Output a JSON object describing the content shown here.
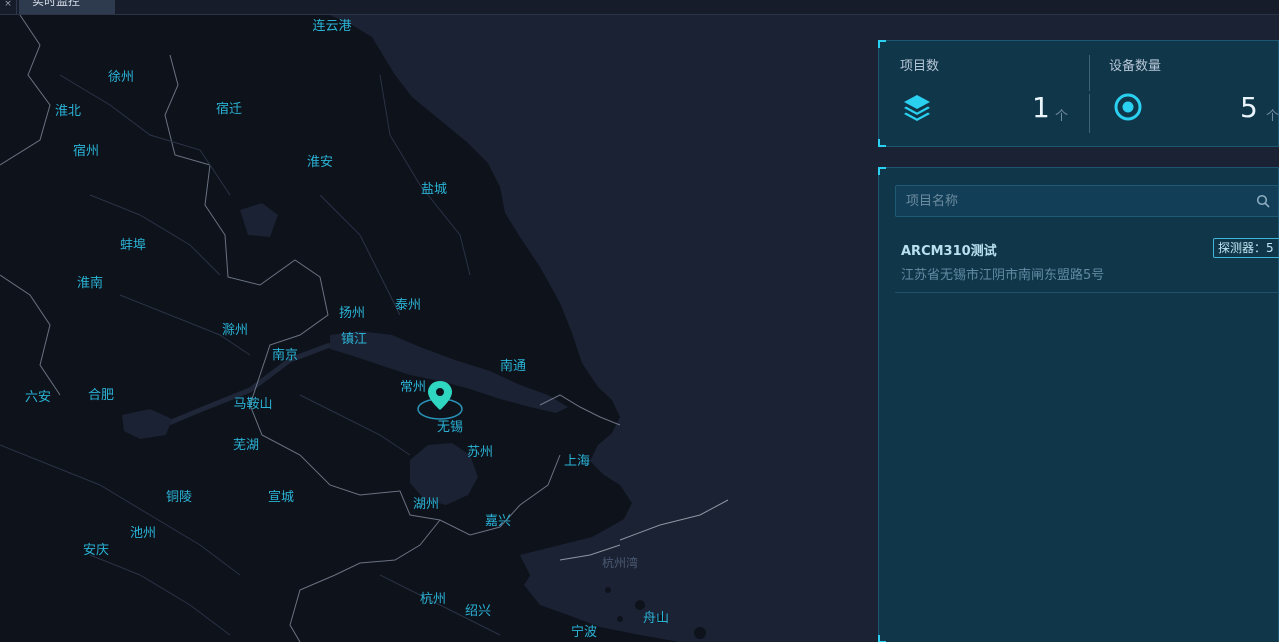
{
  "tabs": {
    "prev_close": "×",
    "active_label": "实时监控",
    "close": "×"
  },
  "map": {
    "cities": [
      {
        "name": "连云港",
        "dim": false
      },
      {
        "name": "徐州",
        "dim": false
      },
      {
        "name": "宿迁",
        "dim": false
      },
      {
        "name": "淮北",
        "dim": false
      },
      {
        "name": "宿州",
        "dim": false
      },
      {
        "name": "淮安",
        "dim": false
      },
      {
        "name": "盐城",
        "dim": false
      },
      {
        "name": "蚌埠",
        "dim": false
      },
      {
        "name": "淮南",
        "dim": false
      },
      {
        "name": "扬州",
        "dim": false
      },
      {
        "name": "泰州",
        "dim": false
      },
      {
        "name": "滁州",
        "dim": false
      },
      {
        "name": "镇江",
        "dim": false
      },
      {
        "name": "南京",
        "dim": false
      },
      {
        "name": "南通",
        "dim": false
      },
      {
        "name": "常州",
        "dim": false
      },
      {
        "name": "六安",
        "dim": false
      },
      {
        "name": "合肥",
        "dim": false
      },
      {
        "name": "马鞍山",
        "dim": false
      },
      {
        "name": "无锡",
        "dim": false
      },
      {
        "name": "芜湖",
        "dim": false
      },
      {
        "name": "苏州",
        "dim": false
      },
      {
        "name": "上海",
        "dim": false
      },
      {
        "name": "铜陵",
        "dim": false
      },
      {
        "name": "宣城",
        "dim": false
      },
      {
        "name": "湖州",
        "dim": false
      },
      {
        "name": "嘉兴",
        "dim": false
      },
      {
        "name": "池州",
        "dim": false
      },
      {
        "name": "安庆",
        "dim": false
      },
      {
        "name": "杭州湾",
        "dim": true
      },
      {
        "name": "杭州",
        "dim": false
      },
      {
        "name": "绍兴",
        "dim": false
      },
      {
        "name": "舟山",
        "dim": false
      },
      {
        "name": "宁波",
        "dim": false
      }
    ],
    "marker_icon": "location-pin-icon",
    "marker_color": "#2fd6c0"
  },
  "stats": {
    "projects": {
      "label": "项目数",
      "value": "1",
      "unit": "个",
      "icon": "layers-icon"
    },
    "devices": {
      "label": "设备数量",
      "value": "5",
      "unit": "个",
      "icon": "target-ring-icon"
    }
  },
  "search": {
    "placeholder": "项目名称",
    "value": "",
    "icon": "search-icon"
  },
  "projects": [
    {
      "name": "ARCM310测试",
      "address": "江苏省无锡市江阴市南闸东盟路5号",
      "badge": "探测器：5"
    }
  ],
  "colors": {
    "accent": "#2ad0f0",
    "map_land": "#0d121b",
    "map_sea": "#1b2233",
    "panel_bg": "#10364a",
    "city_label": "#2bb3d6"
  }
}
